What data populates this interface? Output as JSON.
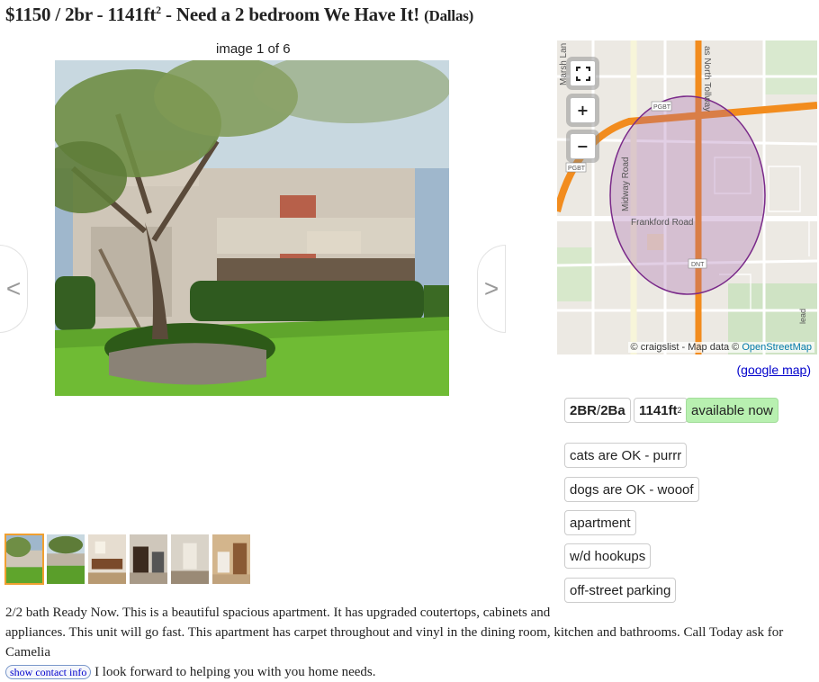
{
  "posting": {
    "price": "$1150",
    "bedrooms": "2br",
    "area": "1141ft",
    "area_sup": "2",
    "headline": "Need a 2 bedroom We Have It!",
    "location": "(Dallas)"
  },
  "gallery": {
    "counter": "image 1 of 6",
    "prev_label": "<",
    "next_label": ">",
    "thumbnail_count": 6,
    "active_thumbnail": 1
  },
  "map": {
    "fullscreen_icon": "fullscreen-icon",
    "zoom_in_label": "+",
    "zoom_out_label": "−",
    "attribution_prefix": "© craigslist - Map data ©",
    "attribution_osm": "OpenStreetMap",
    "road_labels": {
      "midway": "Midway Road",
      "frankford": "Frankford Road",
      "tollway": "as North Tollway",
      "marsh": "Marsh Lan",
      "pgbt1": "PGBT",
      "pgbt2": "PGBT",
      "dnt": "DNT",
      "tx": "lead"
    },
    "google_map_open": "(",
    "google_map_label": "google map",
    "google_map_close": ")"
  },
  "attributes": {
    "br": "2BR",
    "sep": " / ",
    "ba": "2Ba",
    "sqft": "1141ft",
    "sqft_sup": "2",
    "availability": "available now",
    "tags": [
      "cats are OK - purrr",
      "dogs are OK - wooof",
      "apartment",
      "w/d hookups",
      "off-street parking"
    ]
  },
  "description": {
    "line1": "2/2 bath Ready Now. This is a beautiful spacious apartment. It has upgraded coutertops, cabinets and",
    "line2": "appliances. This unit will go fast. This apartment has carpet throughout and vinyl in the dining room, kitchen and bathrooms. Call Today ask for Camelia",
    "contact_button": "show contact info",
    "line3": "I look forward to helping you with you home needs."
  },
  "colors": {
    "availability_bg": "#b8f0b0",
    "highway": "#f28c1e",
    "radius_circle": "#7a2a8a",
    "link": "#0000cc"
  }
}
